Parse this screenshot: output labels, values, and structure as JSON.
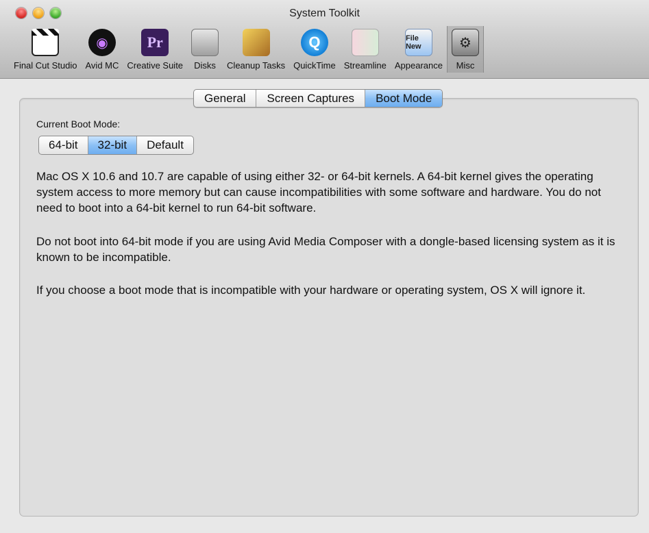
{
  "window": {
    "title": "System Toolkit"
  },
  "toolbar": {
    "items": [
      {
        "label": "Final Cut Studio",
        "icon": "clapperboard-icon"
      },
      {
        "label": "Avid MC",
        "icon": "avid-icon",
        "glyph": "◉"
      },
      {
        "label": "Creative Suite",
        "icon": "premiere-icon",
        "glyph": "Pr"
      },
      {
        "label": "Disks",
        "icon": "hard-disk-icon"
      },
      {
        "label": "Cleanup Tasks",
        "icon": "broom-icon"
      },
      {
        "label": "QuickTime",
        "icon": "quicktime-icon",
        "glyph": "Q"
      },
      {
        "label": "Streamline",
        "icon": "streamline-icon"
      },
      {
        "label": "Appearance",
        "icon": "appearance-icon",
        "glyph": "File\nNew"
      },
      {
        "label": "Misc",
        "icon": "gear-icon",
        "glyph": "⚙",
        "selected": true
      }
    ]
  },
  "tabs": [
    {
      "label": "General"
    },
    {
      "label": "Screen Captures"
    },
    {
      "label": "Boot Mode",
      "selected": true
    }
  ],
  "boot_mode": {
    "label": "Current Boot Mode:",
    "options": [
      "64-bit",
      "32-bit",
      "Default"
    ],
    "selected": "32-bit"
  },
  "paragraphs": [
    "Mac OS X 10.6 and 10.7 are capable of using either 32- or 64-bit kernels. A 64-bit kernel gives the operating system access to more memory but can cause incompatibilities with some software and hardware. You do not need to boot into a 64-bit kernel to run 64-bit software.",
    "Do not boot into 64-bit mode if you are using Avid Media Composer with a dongle-based licensing system as it is known to be incompatible.",
    "If you choose a boot mode that is incompatible with your hardware or operating system, OS X will ignore it."
  ],
  "colors": {
    "selected_gradient_mid": "#8cc0f4",
    "content_background": "#dedede",
    "window_background": "#e8e8e8"
  }
}
